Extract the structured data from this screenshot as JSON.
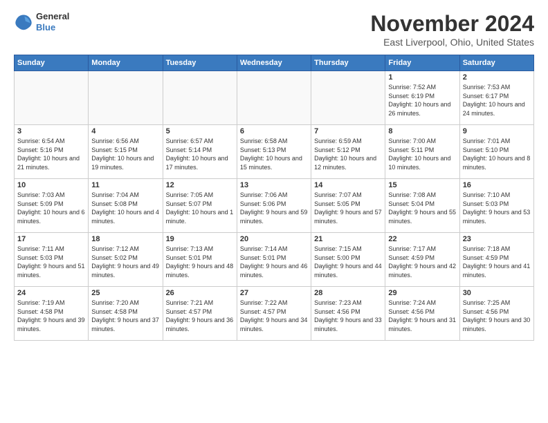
{
  "header": {
    "logo_general": "General",
    "logo_blue": "Blue",
    "title": "November 2024",
    "location": "East Liverpool, Ohio, United States"
  },
  "days_of_week": [
    "Sunday",
    "Monday",
    "Tuesday",
    "Wednesday",
    "Thursday",
    "Friday",
    "Saturday"
  ],
  "weeks": [
    [
      {
        "day": "",
        "empty": true
      },
      {
        "day": "",
        "empty": true
      },
      {
        "day": "",
        "empty": true
      },
      {
        "day": "",
        "empty": true
      },
      {
        "day": "",
        "empty": true
      },
      {
        "day": "1",
        "info": "Sunrise: 7:52 AM\nSunset: 6:19 PM\nDaylight: 10 hours and 26 minutes."
      },
      {
        "day": "2",
        "info": "Sunrise: 7:53 AM\nSunset: 6:17 PM\nDaylight: 10 hours and 24 minutes."
      }
    ],
    [
      {
        "day": "3",
        "info": "Sunrise: 6:54 AM\nSunset: 5:16 PM\nDaylight: 10 hours and 21 minutes."
      },
      {
        "day": "4",
        "info": "Sunrise: 6:56 AM\nSunset: 5:15 PM\nDaylight: 10 hours and 19 minutes."
      },
      {
        "day": "5",
        "info": "Sunrise: 6:57 AM\nSunset: 5:14 PM\nDaylight: 10 hours and 17 minutes."
      },
      {
        "day": "6",
        "info": "Sunrise: 6:58 AM\nSunset: 5:13 PM\nDaylight: 10 hours and 15 minutes."
      },
      {
        "day": "7",
        "info": "Sunrise: 6:59 AM\nSunset: 5:12 PM\nDaylight: 10 hours and 12 minutes."
      },
      {
        "day": "8",
        "info": "Sunrise: 7:00 AM\nSunset: 5:11 PM\nDaylight: 10 hours and 10 minutes."
      },
      {
        "day": "9",
        "info": "Sunrise: 7:01 AM\nSunset: 5:10 PM\nDaylight: 10 hours and 8 minutes."
      }
    ],
    [
      {
        "day": "10",
        "info": "Sunrise: 7:03 AM\nSunset: 5:09 PM\nDaylight: 10 hours and 6 minutes."
      },
      {
        "day": "11",
        "info": "Sunrise: 7:04 AM\nSunset: 5:08 PM\nDaylight: 10 hours and 4 minutes."
      },
      {
        "day": "12",
        "info": "Sunrise: 7:05 AM\nSunset: 5:07 PM\nDaylight: 10 hours and 1 minute."
      },
      {
        "day": "13",
        "info": "Sunrise: 7:06 AM\nSunset: 5:06 PM\nDaylight: 9 hours and 59 minutes."
      },
      {
        "day": "14",
        "info": "Sunrise: 7:07 AM\nSunset: 5:05 PM\nDaylight: 9 hours and 57 minutes."
      },
      {
        "day": "15",
        "info": "Sunrise: 7:08 AM\nSunset: 5:04 PM\nDaylight: 9 hours and 55 minutes."
      },
      {
        "day": "16",
        "info": "Sunrise: 7:10 AM\nSunset: 5:03 PM\nDaylight: 9 hours and 53 minutes."
      }
    ],
    [
      {
        "day": "17",
        "info": "Sunrise: 7:11 AM\nSunset: 5:03 PM\nDaylight: 9 hours and 51 minutes."
      },
      {
        "day": "18",
        "info": "Sunrise: 7:12 AM\nSunset: 5:02 PM\nDaylight: 9 hours and 49 minutes."
      },
      {
        "day": "19",
        "info": "Sunrise: 7:13 AM\nSunset: 5:01 PM\nDaylight: 9 hours and 48 minutes."
      },
      {
        "day": "20",
        "info": "Sunrise: 7:14 AM\nSunset: 5:01 PM\nDaylight: 9 hours and 46 minutes."
      },
      {
        "day": "21",
        "info": "Sunrise: 7:15 AM\nSunset: 5:00 PM\nDaylight: 9 hours and 44 minutes."
      },
      {
        "day": "22",
        "info": "Sunrise: 7:17 AM\nSunset: 4:59 PM\nDaylight: 9 hours and 42 minutes."
      },
      {
        "day": "23",
        "info": "Sunrise: 7:18 AM\nSunset: 4:59 PM\nDaylight: 9 hours and 41 minutes."
      }
    ],
    [
      {
        "day": "24",
        "info": "Sunrise: 7:19 AM\nSunset: 4:58 PM\nDaylight: 9 hours and 39 minutes."
      },
      {
        "day": "25",
        "info": "Sunrise: 7:20 AM\nSunset: 4:58 PM\nDaylight: 9 hours and 37 minutes."
      },
      {
        "day": "26",
        "info": "Sunrise: 7:21 AM\nSunset: 4:57 PM\nDaylight: 9 hours and 36 minutes."
      },
      {
        "day": "27",
        "info": "Sunrise: 7:22 AM\nSunset: 4:57 PM\nDaylight: 9 hours and 34 minutes."
      },
      {
        "day": "28",
        "info": "Sunrise: 7:23 AM\nSunset: 4:56 PM\nDaylight: 9 hours and 33 minutes."
      },
      {
        "day": "29",
        "info": "Sunrise: 7:24 AM\nSunset: 4:56 PM\nDaylight: 9 hours and 31 minutes."
      },
      {
        "day": "30",
        "info": "Sunrise: 7:25 AM\nSunset: 4:56 PM\nDaylight: 9 hours and 30 minutes."
      }
    ]
  ]
}
